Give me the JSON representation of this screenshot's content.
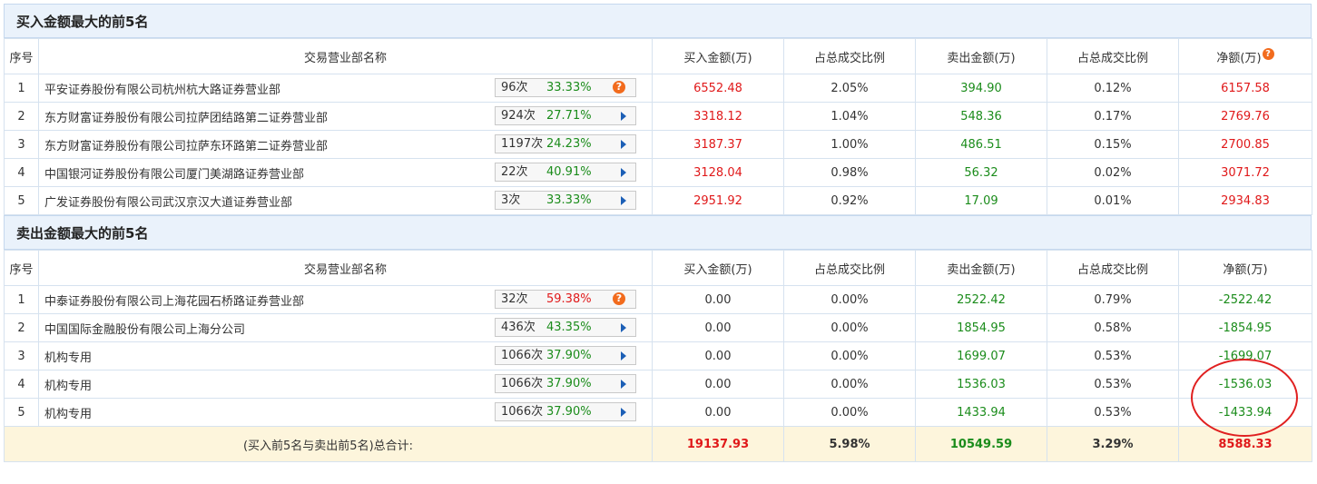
{
  "buy_section": {
    "title": "买入金额最大的前5名",
    "headers": [
      "序号",
      "交易营业部名称",
      "买入金额(万)",
      "占总成交比例",
      "卖出金额(万)",
      "占总成交比例",
      "净额(万)"
    ],
    "rows": [
      {
        "rank": "1",
        "name": "平安证券股份有限公司杭州杭大路证券营业部",
        "count": "96次",
        "pct": "33.33%",
        "buy": "6552.48",
        "buy_ratio": "2.05%",
        "sell": "394.90",
        "sell_ratio": "0.12%",
        "net": "6157.58"
      },
      {
        "rank": "2",
        "name": "东方财富证券股份有限公司拉萨团结路第二证券营业部",
        "count": "924次",
        "pct": "27.71%",
        "buy": "3318.12",
        "buy_ratio": "1.04%",
        "sell": "548.36",
        "sell_ratio": "0.17%",
        "net": "2769.76"
      },
      {
        "rank": "3",
        "name": "东方财富证券股份有限公司拉萨东环路第二证券营业部",
        "count": "1197次",
        "pct": "24.23%",
        "buy": "3187.37",
        "buy_ratio": "1.00%",
        "sell": "486.51",
        "sell_ratio": "0.15%",
        "net": "2700.85"
      },
      {
        "rank": "4",
        "name": "中国银河证券股份有限公司厦门美湖路证券营业部",
        "count": "22次",
        "pct": "40.91%",
        "buy": "3128.04",
        "buy_ratio": "0.98%",
        "sell": "56.32",
        "sell_ratio": "0.02%",
        "net": "3071.72"
      },
      {
        "rank": "5",
        "name": "广发证券股份有限公司武汉京汉大道证券营业部",
        "count": "3次",
        "pct": "33.33%",
        "buy": "2951.92",
        "buy_ratio": "0.92%",
        "sell": "17.09",
        "sell_ratio": "0.01%",
        "net": "2934.83"
      }
    ]
  },
  "sell_section": {
    "title": "卖出金额最大的前5名",
    "headers": [
      "序号",
      "交易营业部名称",
      "买入金额(万)",
      "占总成交比例",
      "卖出金额(万)",
      "占总成交比例",
      "净额(万)"
    ],
    "rows": [
      {
        "rank": "1",
        "name": "中泰证券股份有限公司上海花园石桥路证券营业部",
        "count": "32次",
        "pct": "59.38%",
        "buy": "0.00",
        "buy_ratio": "0.00%",
        "sell": "2522.42",
        "sell_ratio": "0.79%",
        "net": "-2522.42"
      },
      {
        "rank": "2",
        "name": "中国国际金融股份有限公司上海分公司",
        "count": "436次",
        "pct": "43.35%",
        "buy": "0.00",
        "buy_ratio": "0.00%",
        "sell": "1854.95",
        "sell_ratio": "0.58%",
        "net": "-1854.95"
      },
      {
        "rank": "3",
        "name": "机构专用",
        "count": "1066次",
        "pct": "37.90%",
        "buy": "0.00",
        "buy_ratio": "0.00%",
        "sell": "1699.07",
        "sell_ratio": "0.53%",
        "net": "-1699.07"
      },
      {
        "rank": "4",
        "name": "机构专用",
        "count": "1066次",
        "pct": "37.90%",
        "buy": "0.00",
        "buy_ratio": "0.00%",
        "sell": "1536.03",
        "sell_ratio": "0.53%",
        "net": "-1536.03"
      },
      {
        "rank": "5",
        "name": "机构专用",
        "count": "1066次",
        "pct": "37.90%",
        "buy": "0.00",
        "buy_ratio": "0.00%",
        "sell": "1433.94",
        "sell_ratio": "0.53%",
        "net": "-1433.94"
      }
    ]
  },
  "total": {
    "label": "(买入前5名与卖出前5名)总合计:",
    "buy": "19137.93",
    "buy_ratio": "5.98%",
    "sell": "10549.59",
    "sell_ratio": "3.29%",
    "net": "8588.33"
  },
  "help_mark": "?",
  "colors": {
    "red": "#e0191a",
    "green": "#1b8c1b",
    "header_bg": "#eaf2fb",
    "total_bg": "#fdf5dc",
    "help_icon": "#f26b1d",
    "arrow": "#1c5fb6",
    "annotation": "#e02020"
  },
  "icons": {
    "help": "question-circle-icon",
    "expand": "play-arrow-icon"
  }
}
